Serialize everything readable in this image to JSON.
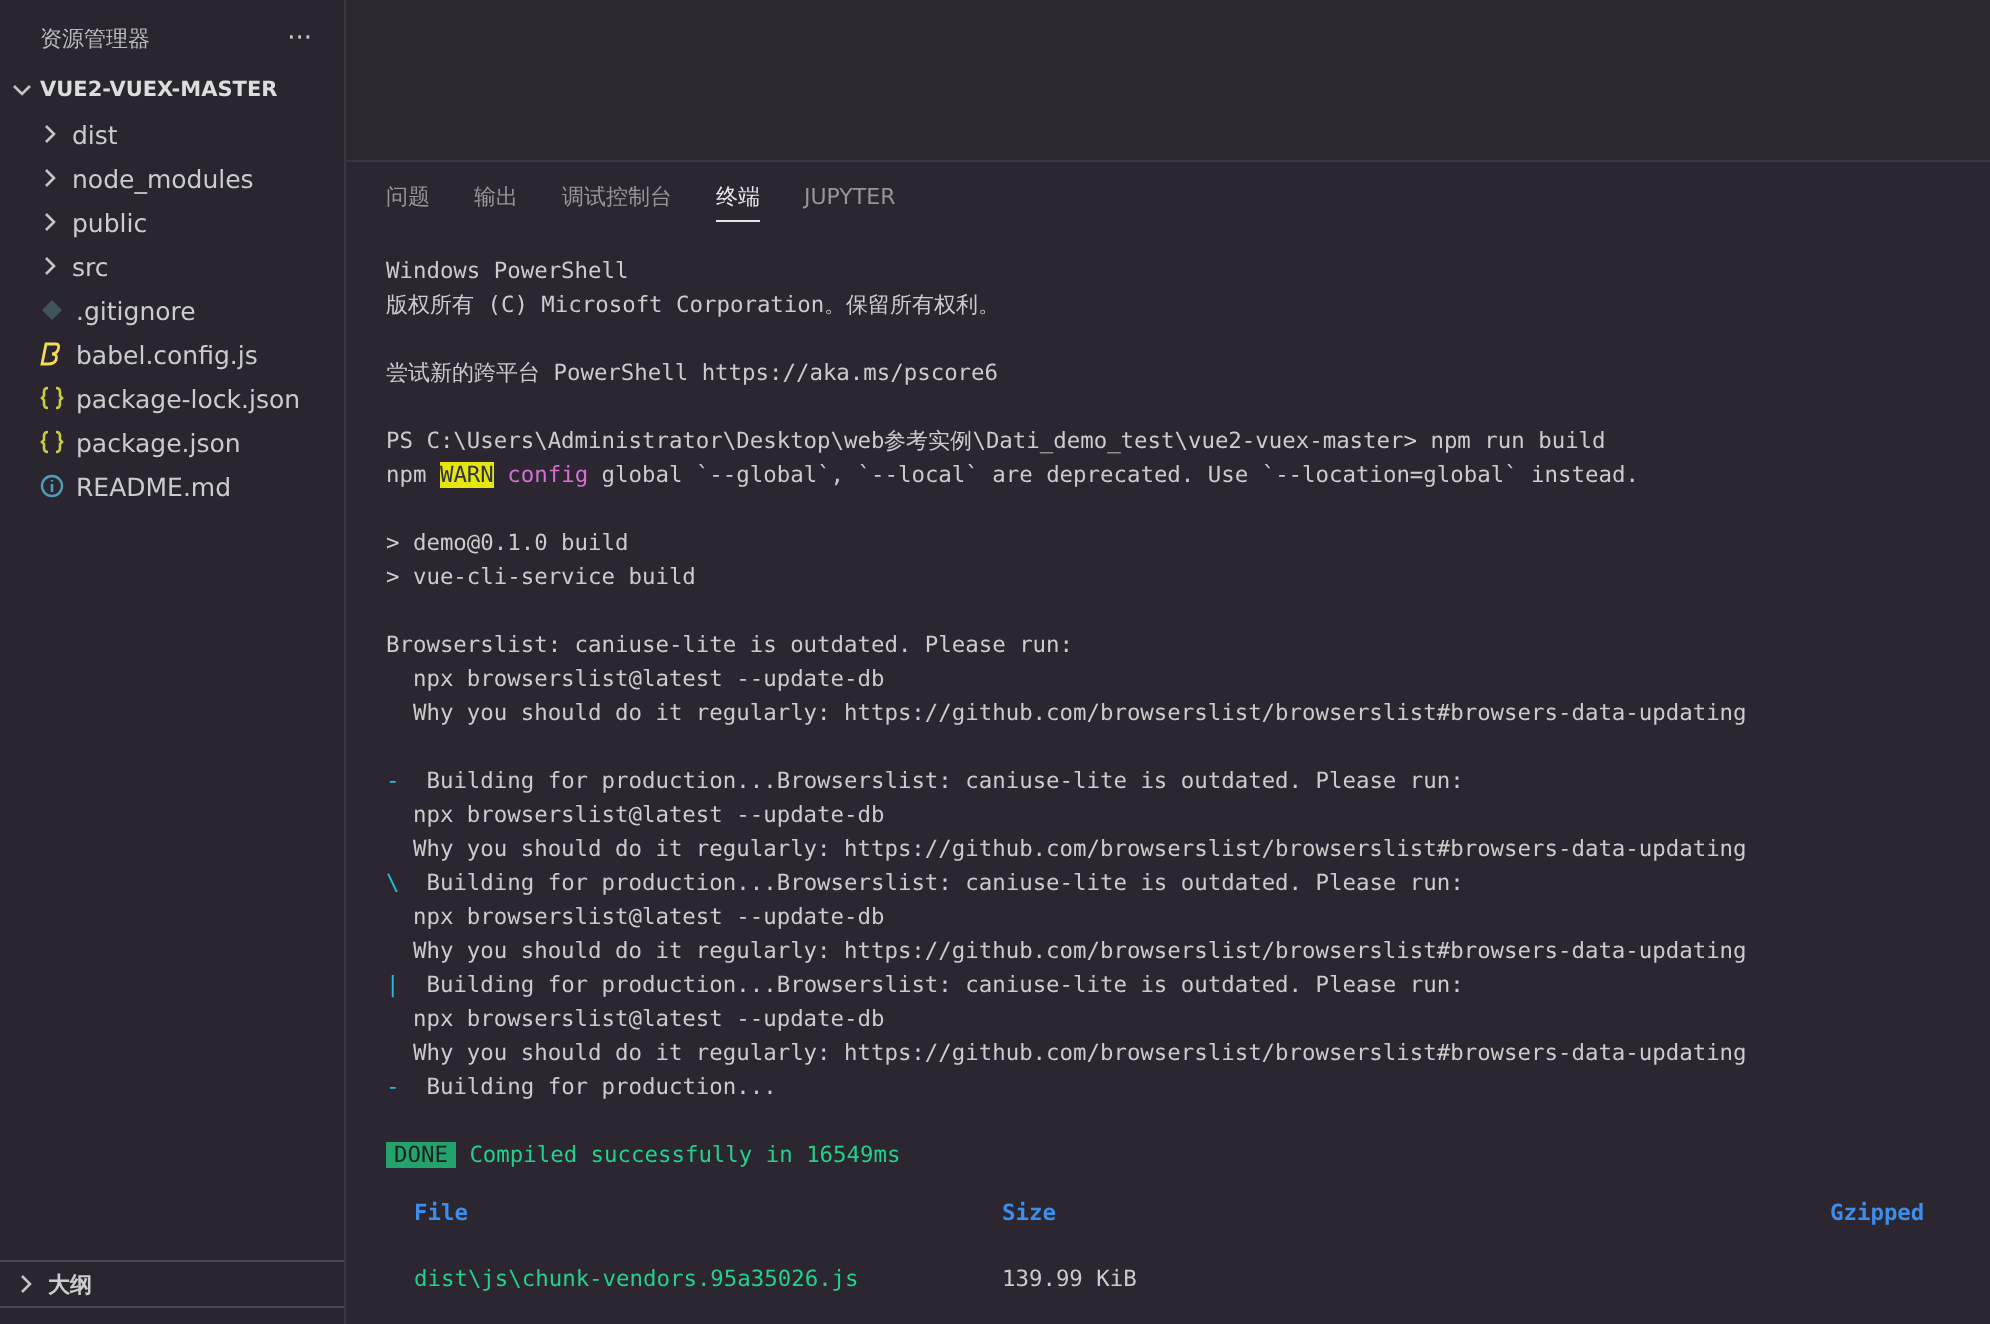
{
  "sidebar": {
    "title": "资源管理器",
    "more": "···",
    "root": {
      "label": "VUE2-VUEX-MASTER",
      "expanded": true
    },
    "items": [
      {
        "label": "dist",
        "kind": "folder",
        "expanded": false
      },
      {
        "label": "node_modules",
        "kind": "folder",
        "expanded": false
      },
      {
        "label": "public",
        "kind": "folder",
        "expanded": false
      },
      {
        "label": "src",
        "kind": "folder",
        "expanded": false
      },
      {
        "label": ".gitignore",
        "kind": "git"
      },
      {
        "label": "babel.config.js",
        "kind": "babel"
      },
      {
        "label": "package-lock.json",
        "kind": "json"
      },
      {
        "label": "package.json",
        "kind": "json"
      },
      {
        "label": "README.md",
        "kind": "info"
      }
    ],
    "outline": {
      "label": "大纲",
      "expanded": false
    }
  },
  "panel": {
    "tabs": [
      {
        "label": "问题",
        "selected": false
      },
      {
        "label": "输出",
        "selected": false
      },
      {
        "label": "调试控制台",
        "selected": false
      },
      {
        "label": "终端",
        "selected": true
      },
      {
        "label": "JUPYTER",
        "selected": false
      }
    ],
    "blocks": [
      [
        [
          {
            "kind": "text",
            "text": "Windows PowerShell"
          }
        ],
        [
          {
            "kind": "text",
            "text": "版权所有 (C) Microsoft Corporation。保留所有权利。"
          }
        ]
      ],
      [
        [
          {
            "kind": "text",
            "text": "尝试新的跨平台 PowerShell https://aka.ms/pscore6"
          }
        ]
      ],
      [
        [
          {
            "kind": "text",
            "text": "PS C:\\Users\\Administrator\\Desktop\\web参考实例\\Dati_demo_test\\vue2-vuex-master> npm run build"
          }
        ],
        [
          {
            "kind": "text",
            "text": "npm "
          },
          {
            "kind": "warning",
            "text": "WARN"
          },
          {
            "kind": "keyword",
            "text": " config"
          },
          {
            "kind": "text",
            "text": " global `--global`, `--local` are deprecated. Use `--location=global` instead."
          }
        ]
      ],
      [
        [
          {
            "kind": "text",
            "text": "> demo@0.1.0 build"
          }
        ],
        [
          {
            "kind": "text",
            "text": "> vue-cli-service build"
          }
        ]
      ],
      [
        [
          {
            "kind": "text",
            "text": "Browserslist: caniuse-lite is outdated. Please run:"
          }
        ],
        [
          {
            "kind": "text",
            "text": "  npx browserslist@latest --update-db"
          }
        ],
        [
          {
            "kind": "text",
            "text": "  Why you should do it regularly: https://github.com/browserslist/browserslist#browsers-data-updating"
          }
        ]
      ],
      [
        [
          {
            "kind": "spinner",
            "text": "-"
          },
          {
            "kind": "text",
            "text": "  Building for production...Browserslist: caniuse-lite is outdated. Please run:"
          }
        ],
        [
          {
            "kind": "text",
            "text": "  npx browserslist@latest --update-db"
          }
        ],
        [
          {
            "kind": "text",
            "text": "  Why you should do it regularly: https://github.com/browserslist/browserslist#browsers-data-updating"
          }
        ],
        [
          {
            "kind": "spinner",
            "text": "\\"
          },
          {
            "kind": "text",
            "text": "  Building for production...Browserslist: caniuse-lite is outdated. Please run:"
          }
        ],
        [
          {
            "kind": "text",
            "text": "  npx browserslist@latest --update-db"
          }
        ],
        [
          {
            "kind": "text",
            "text": "  Why you should do it regularly: https://github.com/browserslist/browserslist#browsers-data-updating"
          }
        ],
        [
          {
            "kind": "spinner",
            "text": "|"
          },
          {
            "kind": "text",
            "text": "  Building for production...Browserslist: caniuse-lite is outdated. Please run:"
          }
        ],
        [
          {
            "kind": "text",
            "text": "  npx browserslist@latest --update-db"
          }
        ],
        [
          {
            "kind": "text",
            "text": "  Why you should do it regularly: https://github.com/browserslist/browserslist#browsers-data-updating"
          }
        ],
        [
          {
            "kind": "spinner",
            "text": "-"
          },
          {
            "kind": "text",
            "text": "  Building for production..."
          }
        ]
      ],
      [
        [
          {
            "kind": "done",
            "text": "DONE"
          },
          {
            "kind": "success",
            "text": " Compiled successfully in 16549ms"
          }
        ]
      ]
    ],
    "table": {
      "columns": [
        "File",
        "Size",
        "Gzipped"
      ],
      "rows": [
        [
          "dist\\js\\chunk-vendors.95a35026.js",
          "139.99 KiB"
        ]
      ]
    }
  }
}
